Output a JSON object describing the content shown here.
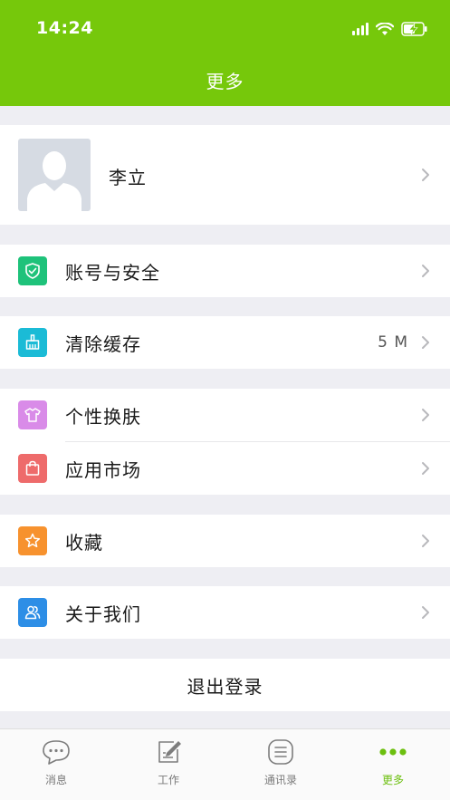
{
  "status_bar": {
    "time": "14:24"
  },
  "header": {
    "title": "更多"
  },
  "profile": {
    "name": "李立"
  },
  "menu": {
    "account_security": "账号与安全",
    "clear_cache": "清除缓存",
    "cache_size": "5 M",
    "skin": "个性换肤",
    "app_market": "应用市场",
    "favorites": "收藏",
    "about": "关于我们"
  },
  "logout": {
    "label": "退出登录"
  },
  "tabbar": {
    "messages": "消息",
    "work": "工作",
    "contacts": "通讯录",
    "more": "更多"
  },
  "colors": {
    "accent": "#76c80b",
    "icon_account": "#1ec27a",
    "icon_cache": "#1bbbd6",
    "icon_skin": "#d98be8",
    "icon_market": "#ee6b6b",
    "icon_favorites": "#f7922e",
    "icon_about": "#2d8ee6"
  }
}
